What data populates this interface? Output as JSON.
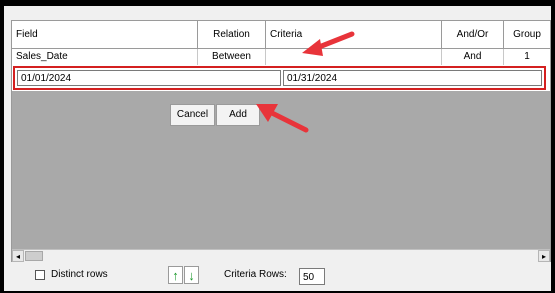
{
  "grid": {
    "columns": [
      "Field",
      "Relation",
      "Criteria",
      "And/Or",
      "Group"
    ],
    "row": {
      "field": "Sales_Date",
      "relation": "Between",
      "criteria": "",
      "and_or": "And",
      "group": "1"
    },
    "editor": {
      "from_value": "01/01/2024",
      "to_value": "01/31/2024"
    }
  },
  "buttons": {
    "cancel": "Cancel",
    "add": "Add"
  },
  "scrollbar": {
    "left_arrow": "◂",
    "right_arrow": "▸"
  },
  "footer": {
    "distinct_rows": "Distinct rows",
    "criteria_rows_label": "Criteria Rows:",
    "criteria_rows_value": "50",
    "move_up": "↑",
    "move_down": "↓"
  },
  "colors": {
    "highlight": "#d42020",
    "annotation_arrow": "#e8343a",
    "move_arrows": "#1e9a2e"
  },
  "icons": [
    "green-up-arrow-icon",
    "green-down-arrow-icon",
    "red-annotation-arrow"
  ]
}
